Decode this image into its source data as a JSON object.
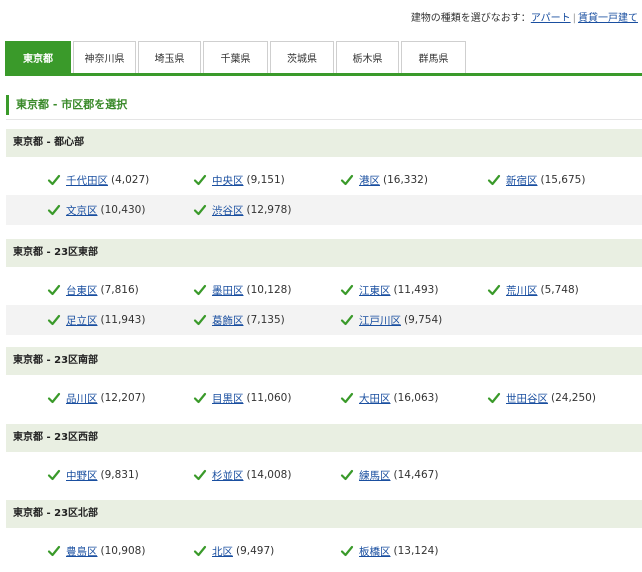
{
  "topbar": {
    "prompt": "建物の種類を選びなおす：",
    "link_apartment": "アパート",
    "separator": "|",
    "link_house": "賃貸一戸建て"
  },
  "tabs": [
    {
      "label": "東京都",
      "active": true
    },
    {
      "label": "神奈川県",
      "active": false
    },
    {
      "label": "埼玉県",
      "active": false
    },
    {
      "label": "千葉県",
      "active": false
    },
    {
      "label": "茨城県",
      "active": false
    },
    {
      "label": "栃木県",
      "active": false
    },
    {
      "label": "群馬県",
      "active": false
    }
  ],
  "page_heading": "東京都 - 市区郡を選択",
  "colors": {
    "accent": "#3a9a2a",
    "link": "#1a4fa0",
    "group_bg": "#e9efe2",
    "check": "#3a9a2a"
  },
  "check_icon": "checkmark-icon",
  "groups": [
    {
      "title": "東京都 - 都心部",
      "items": [
        {
          "name": "千代田区",
          "count": "(4,027)"
        },
        {
          "name": "中央区",
          "count": "(9,151)"
        },
        {
          "name": "港区",
          "count": "(16,332)"
        },
        {
          "name": "新宿区",
          "count": "(15,675)"
        },
        {
          "name": "文京区",
          "count": "(10,430)"
        },
        {
          "name": "渋谷区",
          "count": "(12,978)"
        }
      ]
    },
    {
      "title": "東京都 - 23区東部",
      "items": [
        {
          "name": "台東区",
          "count": "(7,816)"
        },
        {
          "name": "墨田区",
          "count": "(10,128)"
        },
        {
          "name": "江東区",
          "count": "(11,493)"
        },
        {
          "name": "荒川区",
          "count": "(5,748)"
        },
        {
          "name": "足立区",
          "count": "(11,943)"
        },
        {
          "name": "葛飾区",
          "count": "(7,135)"
        },
        {
          "name": "江戸川区",
          "count": "(9,754)"
        }
      ]
    },
    {
      "title": "東京都 - 23区南部",
      "items": [
        {
          "name": "品川区",
          "count": "(12,207)"
        },
        {
          "name": "目黒区",
          "count": "(11,060)"
        },
        {
          "name": "大田区",
          "count": "(16,063)"
        },
        {
          "name": "世田谷区",
          "count": "(24,250)"
        }
      ]
    },
    {
      "title": "東京都 - 23区西部",
      "items": [
        {
          "name": "中野区",
          "count": "(9,831)"
        },
        {
          "name": "杉並区",
          "count": "(14,008)"
        },
        {
          "name": "練馬区",
          "count": "(14,467)"
        }
      ]
    },
    {
      "title": "東京都 - 23区北部",
      "items": [
        {
          "name": "豊島区",
          "count": "(10,908)"
        },
        {
          "name": "北区",
          "count": "(9,497)"
        },
        {
          "name": "板橋区",
          "count": "(13,124)"
        }
      ]
    }
  ]
}
